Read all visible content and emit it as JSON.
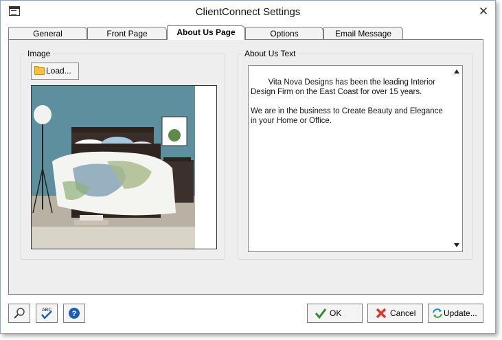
{
  "window": {
    "title": "ClientConnect Settings"
  },
  "tabs": [
    {
      "label": "General"
    },
    {
      "label": "Front Page"
    },
    {
      "label": "About Us Page",
      "active": true
    },
    {
      "label": "Options"
    },
    {
      "label": "Email Message"
    }
  ],
  "image_group": {
    "label": "Image",
    "load_button": "Load...",
    "picture_description": "bedroom with teal wall, white floral bedding, dark wood bed, floor lamp and nightstand"
  },
  "about_group": {
    "label": "About Us Text",
    "text": "Vita Nova Designs has been the leading Interior Design Firm on the East Coast for over 15 years.\n\nWe are in the business to Create Beauty and Elegance in your Home or Office."
  },
  "footer": {
    "ok": "OK",
    "cancel": "Cancel",
    "update": "Update..."
  },
  "colors": {
    "ok_check": "#2e8b3a",
    "cancel_x": "#d93c2c",
    "help_blue": "#1c5fb4",
    "wall_teal": "#5e8f9e"
  }
}
